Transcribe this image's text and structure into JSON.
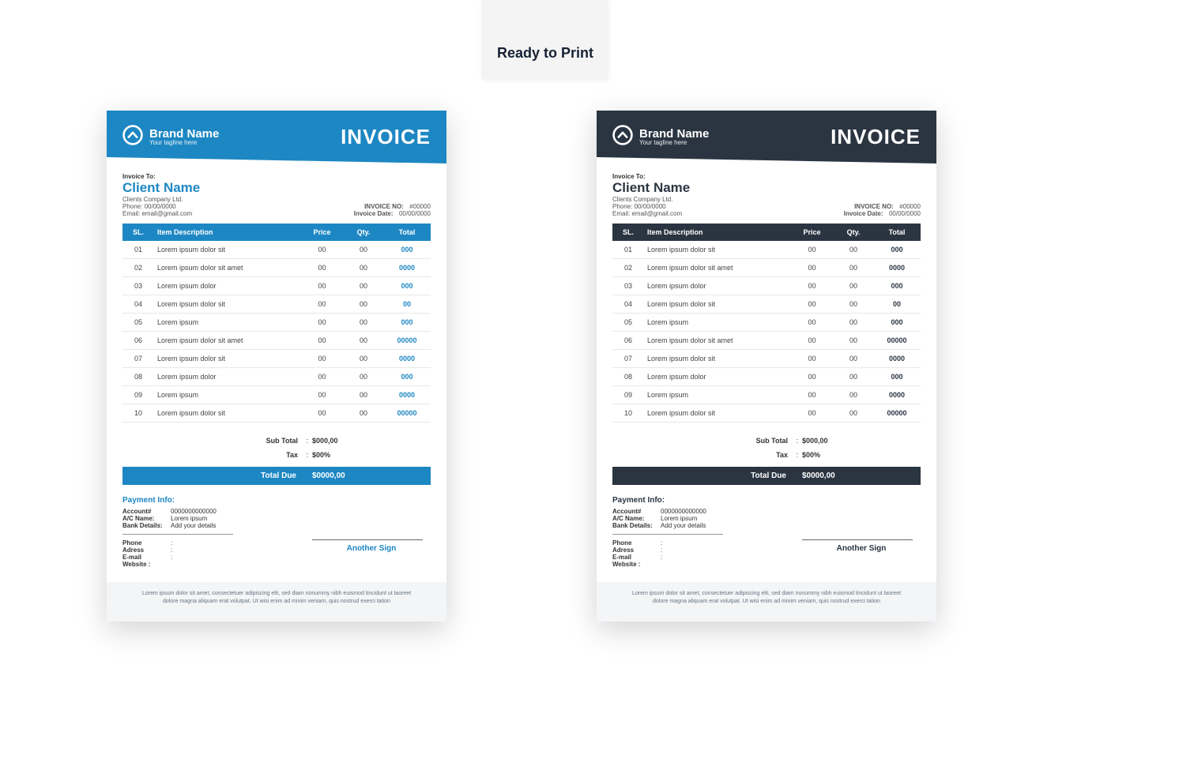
{
  "badge": "Ready to Print",
  "brand": {
    "name": "Brand Name",
    "tagline": "Your tagline here"
  },
  "invoice_title": "INVOICE",
  "invoice_to_label": "Invoice To:",
  "client_name": "Client Name",
  "client_company": "Clients Company Ltd.",
  "client_phone": "Phone: 00/00/0000",
  "client_email": "Email: email@gmail.com",
  "invoice_no_label": "INVOICE NO:",
  "invoice_no_value": "#00000",
  "invoice_date_label": "Invoice Date:",
  "invoice_date_value": "00/00/0000",
  "cols": {
    "sl": "SL.",
    "desc": "Item Description",
    "price": "Price",
    "qty": "Qty.",
    "total": "Total"
  },
  "items": [
    {
      "sl": "01",
      "desc": "Lorem ipsum dolor sit",
      "price": "00",
      "qty": "00",
      "total": "000"
    },
    {
      "sl": "02",
      "desc": "Lorem ipsum dolor sit amet",
      "price": "00",
      "qty": "00",
      "total": "0000"
    },
    {
      "sl": "03",
      "desc": "Lorem ipsum dolor",
      "price": "00",
      "qty": "00",
      "total": "000"
    },
    {
      "sl": "04",
      "desc": "Lorem ipsum dolor sit",
      "price": "00",
      "qty": "00",
      "total": "00"
    },
    {
      "sl": "05",
      "desc": "Lorem ipsum",
      "price": "00",
      "qty": "00",
      "total": "000"
    },
    {
      "sl": "06",
      "desc": "Lorem ipsum dolor sit amet",
      "price": "00",
      "qty": "00",
      "total": "00000"
    },
    {
      "sl": "07",
      "desc": "Lorem ipsum dolor sit",
      "price": "00",
      "qty": "00",
      "total": "0000"
    },
    {
      "sl": "08",
      "desc": "Lorem ipsum dolor",
      "price": "00",
      "qty": "00",
      "total": "000"
    },
    {
      "sl": "09",
      "desc": "Lorem ipsum",
      "price": "00",
      "qty": "00",
      "total": "0000"
    },
    {
      "sl": "10",
      "desc": "Lorem ipsum dolor sit",
      "price": "00",
      "qty": "00",
      "total": "00000"
    }
  ],
  "subtotal_label": "Sub Total",
  "subtotal_value": "$000,00",
  "tax_label": "Tax",
  "tax_value": "$00%",
  "total_due_label": "Total Due",
  "total_due_value": "$0000,00",
  "payment": {
    "title": "Payment Info:",
    "account_k": "Account#",
    "account_v": "0000000000000",
    "acname_k": "A/C Name:",
    "acname_v": "Lorem ipsum",
    "bank_k": "Bank Details:",
    "bank_v": "Add your details",
    "phone_k": "Phone",
    "address_k": "Adress",
    "email_k": "E-mail",
    "website_k": "Website :"
  },
  "sign_label": "Another Sign",
  "footer": "Lorem ipsum dolor sit amet, consectetuer adipiscing elit, sed diam nonummy nibh euismod tincidunt ut laoreet dolore magna aliquam erat volutpat. Ut wisi enim ad minim veniam, quis nostrud exerci tation"
}
